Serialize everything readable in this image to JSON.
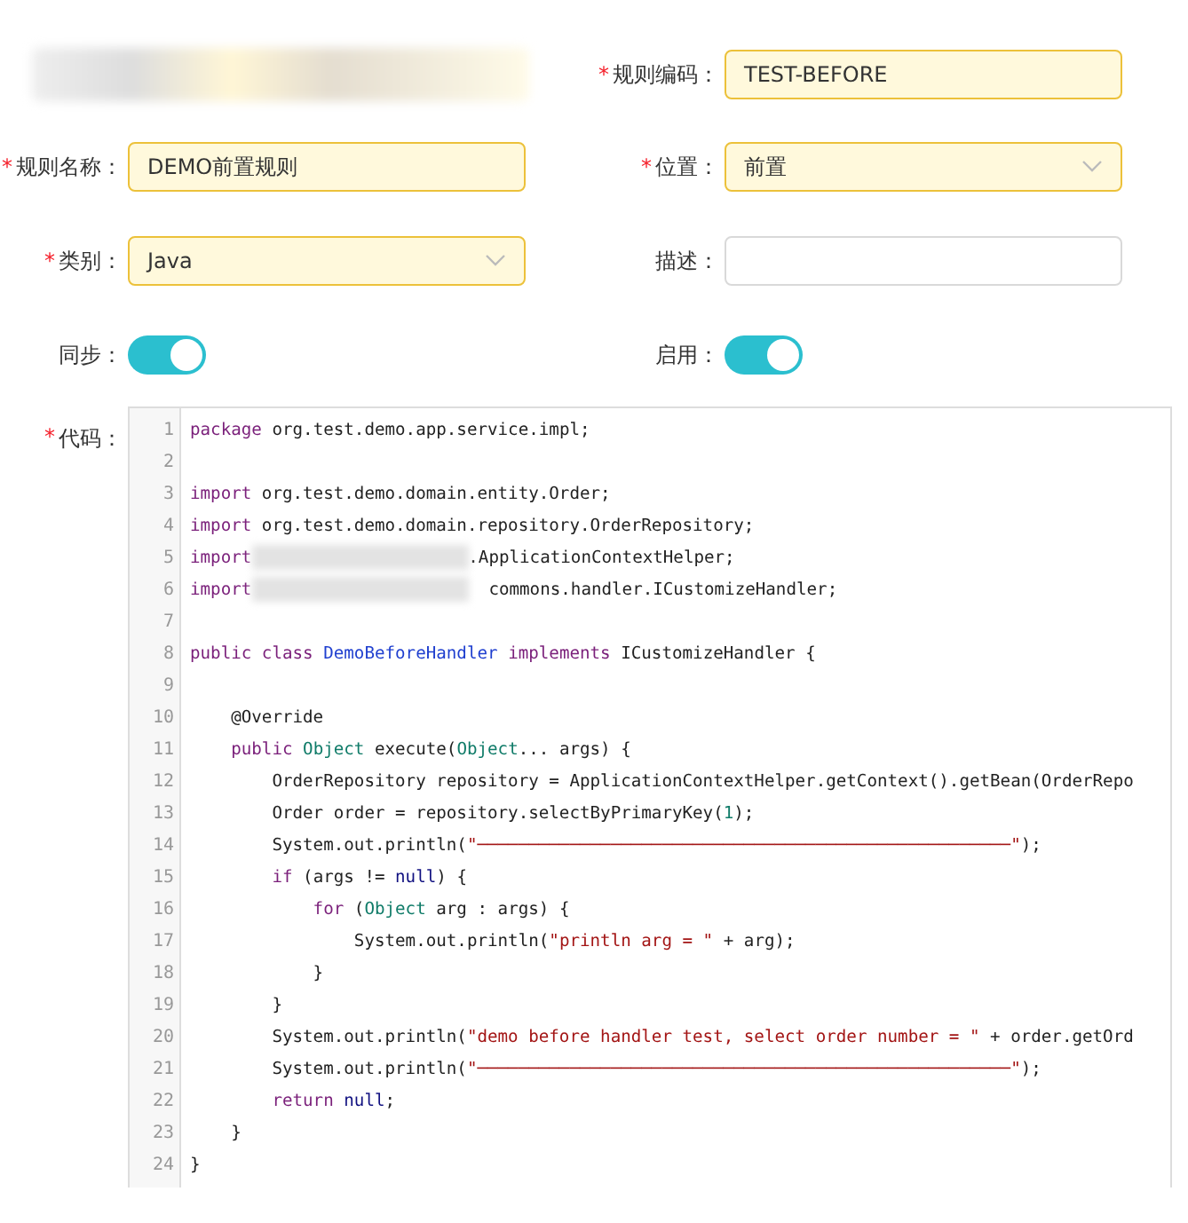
{
  "form": {
    "rows": [
      [
        {
          "kind": "blurred"
        },
        {
          "kind": "input",
          "label": "规则编码：",
          "required_mark": "*",
          "value": "TEST-BEFORE",
          "highlighted": true
        }
      ],
      [
        {
          "kind": "input",
          "label": "规则名称：",
          "required_mark": "*",
          "value": "DEMO前置规则",
          "highlighted": true
        },
        {
          "kind": "select",
          "label": "位置：",
          "required_mark": "*",
          "value": "前置",
          "highlighted": true
        }
      ],
      [
        {
          "kind": "select",
          "label": "类别：",
          "required_mark": "*",
          "value": "Java",
          "highlighted": true
        },
        {
          "kind": "input",
          "label": "描述：",
          "highlighted": false
        }
      ],
      [
        {
          "kind": "switch",
          "label": "同步：",
          "on": true
        },
        {
          "kind": "switch",
          "label": "启用：",
          "on": true
        }
      ]
    ]
  },
  "code_field": {
    "label": "代码：",
    "required_mark": "*",
    "lines": [
      {
        "number": "1",
        "tokens": [
          {
            "kind": "kw",
            "text": "package"
          },
          {
            "kind": "plain",
            "text": " org.test.demo.app.service.impl;"
          }
        ]
      },
      {
        "number": "2"
      },
      {
        "number": "3",
        "tokens": [
          {
            "kind": "kw",
            "text": "import"
          },
          {
            "kind": "plain",
            "text": " org.test.demo.domain.entity.Order;"
          }
        ]
      },
      {
        "number": "4",
        "tokens": [
          {
            "kind": "kw",
            "text": "import"
          },
          {
            "kind": "plain",
            "text": " org.test.demo.domain.repository.OrderRepository;"
          }
        ]
      },
      {
        "number": "5",
        "tokens": [
          {
            "kind": "kw",
            "text": "import"
          },
          {
            "kind": "redacted"
          },
          {
            "kind": "plain",
            "text": ".ApplicationContextHelper;"
          }
        ]
      },
      {
        "number": "6",
        "tokens": [
          {
            "kind": "kw",
            "text": "import"
          },
          {
            "kind": "redacted"
          },
          {
            "kind": "plain",
            "text": "  commons.handler.ICustomizeHandler;"
          }
        ]
      },
      {
        "number": "7"
      },
      {
        "number": "8",
        "tokens": [
          {
            "kind": "kw",
            "text": "public class "
          },
          {
            "kind": "cls",
            "text": "DemoBeforeHandler"
          },
          {
            "kind": "kw",
            "text": " implements "
          },
          {
            "kind": "plain",
            "text": "ICustomizeHandler {"
          }
        ]
      },
      {
        "number": "9"
      },
      {
        "number": "10",
        "tokens": [
          {
            "kind": "plain",
            "text": "    @Override"
          }
        ]
      },
      {
        "number": "11",
        "tokens": [
          {
            "kind": "kw",
            "text": "    public "
          },
          {
            "kind": "type",
            "text": "Object"
          },
          {
            "kind": "plain",
            "text": " execute("
          },
          {
            "kind": "type",
            "text": "Object"
          },
          {
            "kind": "plain",
            "text": "... args) {"
          }
        ]
      },
      {
        "number": "12",
        "tokens": [
          {
            "kind": "plain",
            "text": "        OrderRepository repository = ApplicationContextHelper.getContext().getBean(OrderRepo"
          }
        ]
      },
      {
        "number": "13",
        "tokens": [
          {
            "kind": "plain",
            "text": "        Order order = repository.selectByPrimaryKey("
          },
          {
            "kind": "num",
            "text": "1"
          },
          {
            "kind": "plain",
            "text": ");"
          }
        ]
      },
      {
        "number": "14",
        "tokens": [
          {
            "kind": "plain",
            "text": "        System.out.println("
          },
          {
            "kind": "str",
            "text": "\"────────────────────────────────────────────────────\""
          },
          {
            "kind": "plain",
            "text": ");"
          }
        ]
      },
      {
        "number": "15",
        "tokens": [
          {
            "kind": "kw",
            "text": "        if"
          },
          {
            "kind": "plain",
            "text": " (args != "
          },
          {
            "kind": "lit",
            "text": "null"
          },
          {
            "kind": "plain",
            "text": ") {"
          }
        ]
      },
      {
        "number": "16",
        "tokens": [
          {
            "kind": "kw",
            "text": "            for"
          },
          {
            "kind": "plain",
            "text": " ("
          },
          {
            "kind": "type",
            "text": "Object"
          },
          {
            "kind": "plain",
            "text": " arg : args) {"
          }
        ]
      },
      {
        "number": "17",
        "tokens": [
          {
            "kind": "plain",
            "text": "                System.out.println("
          },
          {
            "kind": "str",
            "text": "\"println arg = \""
          },
          {
            "kind": "plain",
            "text": " + arg);"
          }
        ]
      },
      {
        "number": "18",
        "tokens": [
          {
            "kind": "plain",
            "text": "            }"
          }
        ]
      },
      {
        "number": "19",
        "tokens": [
          {
            "kind": "plain",
            "text": "        }"
          }
        ]
      },
      {
        "number": "20",
        "tokens": [
          {
            "kind": "plain",
            "text": "        System.out.println("
          },
          {
            "kind": "str",
            "text": "\"demo before handler test, select order number = \""
          },
          {
            "kind": "plain",
            "text": " + order.getOrd"
          }
        ]
      },
      {
        "number": "21",
        "tokens": [
          {
            "kind": "plain",
            "text": "        System.out.println("
          },
          {
            "kind": "str",
            "text": "\"────────────────────────────────────────────────────\""
          },
          {
            "kind": "plain",
            "text": ");"
          }
        ]
      },
      {
        "number": "22",
        "tokens": [
          {
            "kind": "kw",
            "text": "        return"
          },
          {
            "kind": "lit",
            "text": " null"
          },
          {
            "kind": "plain",
            "text": ";"
          }
        ]
      },
      {
        "number": "23",
        "tokens": [
          {
            "kind": "plain",
            "text": "    }"
          }
        ]
      },
      {
        "number": "24",
        "tokens": [
          {
            "kind": "plain",
            "text": "}"
          }
        ]
      }
    ]
  }
}
